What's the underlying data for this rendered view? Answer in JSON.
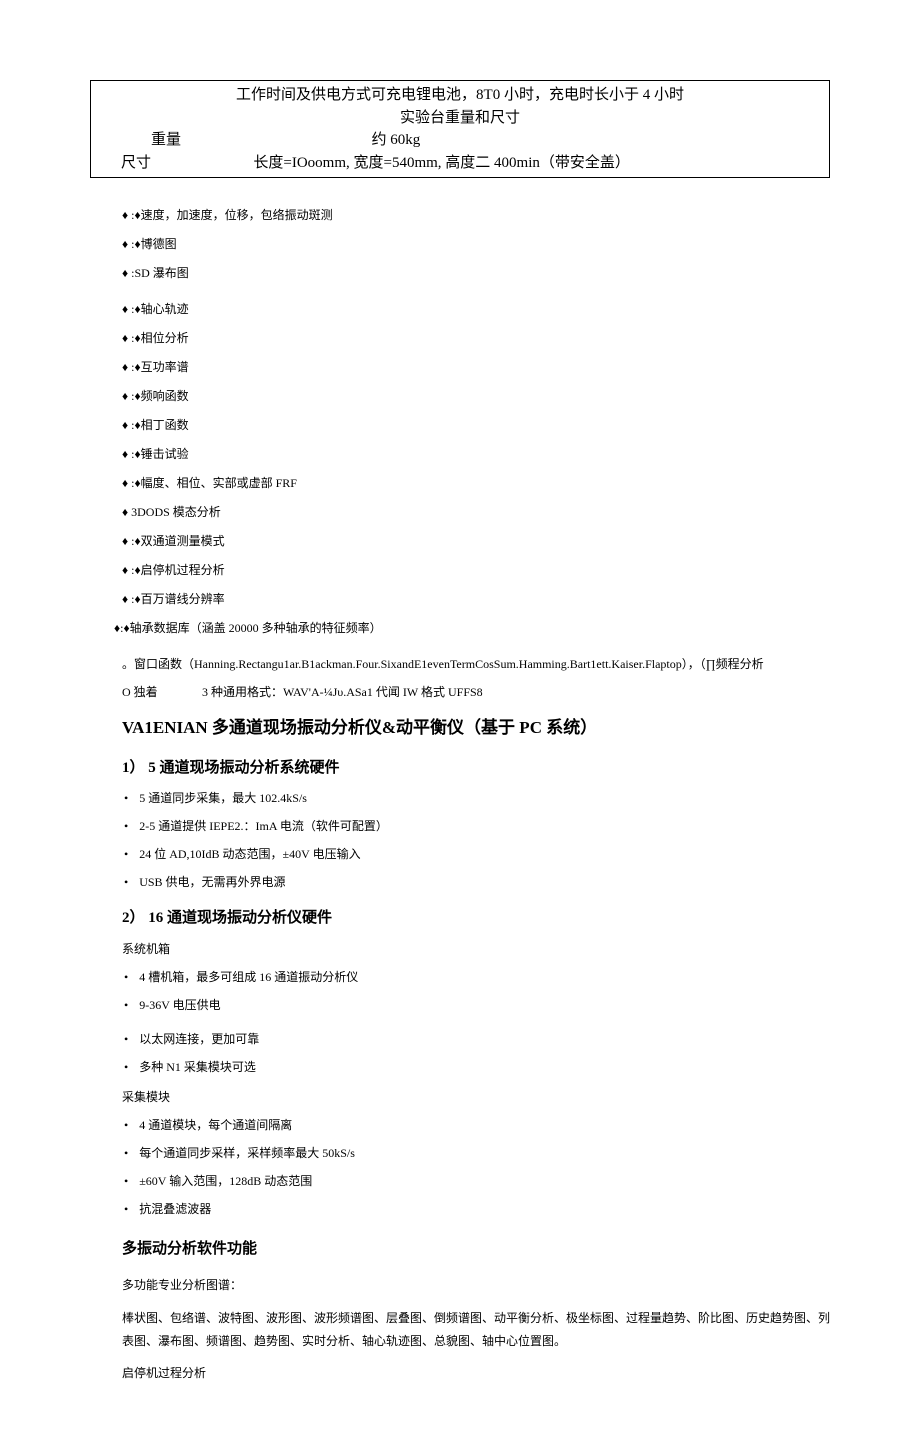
{
  "table": {
    "row1": "工作时间及供电方式可充电锂电池，8T0 小时，充电时长小于 4 小时",
    "row2": "实验台重量和尺寸",
    "weight_label": "重量",
    "weight_value": "约 60kg",
    "dim_label": "尺寸",
    "dim_value": "长度=IOoomm, 宽度=540mm, 高度二 400min（带安全盖）"
  },
  "diamond_items": [
    "♦ :♦速度，加速度，位移，包络振动斑测",
    "♦ :♦博德图",
    "♦ :SD 瀑布图",
    "♦ :♦轴心轨迹",
    "♦ :♦相位分析",
    "♦ :♦互功率谱",
    "♦ :♦频响函数",
    "♦ :♦相丁函数",
    "♦ :♦锤击试验",
    "♦ :♦幅度、相位、实部或虚部 FRF",
    "♦     3DODS 模态分析",
    "♦ :♦双通道测量模式",
    "♦ :♦启停机过程分析",
    "♦ :♦百万谱线分辨率",
    "♦:♦轴承数据库（涵盖 20000 多种轴承的特征频率）"
  ],
  "circle_line": "。窗口函数（Hanning.Rectangu1ar.B1ackman.Four.SixandE1evenTermCosSum.Hamming.Bart1ett.Kaiser.Flaptop），（∏频程分析",
  "o_label": "O 独着",
  "o_value": "3 种通用格式：WAV'A-¼Jυ.ASa1 代闻 IW 格式 UFFS8",
  "title": "VA1ENIAN 多通道现场振动分析仪&动平衡仪（基于 PC 系统）",
  "sec1_head": "1） 5 通道现场振动分析系统硬件",
  "sec1_items": [
    "5 通道同步采集，最大 102.4kS/s",
    "2-5 通道提供 IEPE2.：ImA 电流（软件可配置）",
    "24 位 AD,10IdB 动态范围，±40V 电压输入",
    "USB 供电，无需再外界电源"
  ],
  "sec2_head": "2） 16 通道现场振动分析仪硬件",
  "box_label": "系统机箱",
  "box_items": [
    "4 槽机箱，最多可组成 16 通道振动分析仪",
    "9-36V 电压供电",
    "以太网连接，更加可靠",
    "多种 N1 采集模块可选"
  ],
  "mod_label": "采集模块",
  "mod_items": [
    "4 通道模块，每个通道间隔离",
    "每个通道同步采样，采样频率最大 50kS/s",
    "±60V 输入范围，128dB 动态范围",
    "抗混叠滤波器"
  ],
  "sw_head": "多振动分析软件功能",
  "sw_p1": "多功能专业分析图谱：",
  "sw_p2": "棒状图、包络谱、波特图、波形图、波形频谱图、层叠图、倒频谱图、动平衡分析、极坐标图、过程量趋势、阶比图、历史趋势图、列表图、瀑布图、频谱图、趋势图、实时分析、轴心轨迹图、总貌图、轴中心位置图。",
  "sw_p3": "启停机过程分析"
}
